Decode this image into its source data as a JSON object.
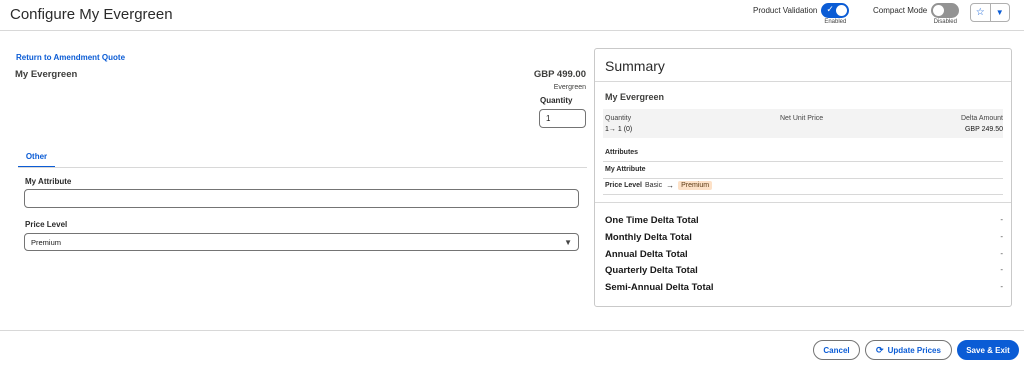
{
  "header": {
    "title": "Configure My Evergreen",
    "product_validation": {
      "label": "Product Validation",
      "state": "Enabled"
    },
    "compact_mode": {
      "label": "Compact Mode",
      "state": "Disabled"
    },
    "favorite_icon": "star-icon",
    "favorite_menu_icon": "caret-down-icon"
  },
  "form": {
    "return_link": "Return to Amendment Quote",
    "product_name": "My Evergreen",
    "price": "GBP 499.00",
    "price_type": "Evergreen",
    "quantity_label": "Quantity",
    "quantity_value": "1",
    "tab": "Other",
    "my_attribute_label": "My Attribute",
    "my_attribute_value": "",
    "price_level_label": "Price Level",
    "price_level_value": "Premium"
  },
  "summary": {
    "title": "Summary",
    "product": "My Evergreen",
    "col_quantity": "Quantity",
    "col_net_unit_price": "Net Unit Price",
    "col_delta_amount": "Delta Amount",
    "quantity_from": "1",
    "quantity_to": "1 (0)",
    "delta_amount": "GBP 249.50",
    "attributes_heading": "Attributes",
    "my_attribute": "My Attribute",
    "price_level_label": "Price Level",
    "price_level_old": "Basic",
    "price_level_new": "Premium",
    "totals": [
      {
        "label": "One Time Delta Total",
        "value": "-"
      },
      {
        "label": "Monthly Delta Total",
        "value": "-"
      },
      {
        "label": "Annual Delta Total",
        "value": "-"
      },
      {
        "label": "Quarterly Delta Total",
        "value": "-"
      },
      {
        "label": "Semi-Annual Delta Total",
        "value": "-"
      }
    ]
  },
  "footer": {
    "cancel": "Cancel",
    "update_prices": "Update Prices",
    "save_exit": "Save & Exit"
  },
  "colors": {
    "brand": "#0b5cd5",
    "badge": "#fde1c7"
  }
}
